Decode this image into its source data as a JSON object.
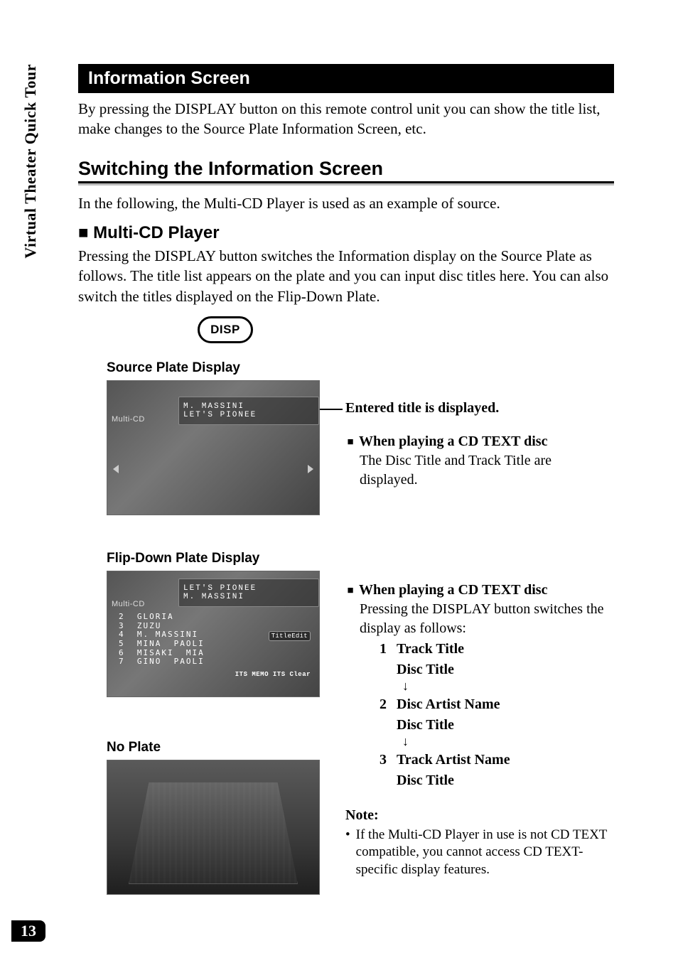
{
  "sidebar": {
    "tab_label": "Virtual Theater Quick Tour"
  },
  "page_number": "13",
  "header": {
    "title": "Information Screen"
  },
  "intro": "By pressing the DISPLAY button on this remote control unit you can show the title list, make changes to the Source Plate Information Screen, etc.",
  "section": {
    "heading": "Switching the Information Screen",
    "body": "In the following, the Multi-CD Player is used as an example of source."
  },
  "multicd": {
    "heading_prefix": "■  ",
    "heading": "Multi-CD Player",
    "body": "Pressing the DISPLAY button switches the Information display on the Source Plate as follows. The title list appears on the plate and you can input disc titles here. You can also switch the titles displayed on the Flip-Down Plate."
  },
  "disp_button_label": "DISP",
  "source_plate": {
    "label": "Source Plate Display",
    "callout": "Entered title is displayed.",
    "cdtext_title": "When playing a CD TEXT disc",
    "cdtext_body": "The Disc Title and Track Title are displayed.",
    "scr_source": "Multi-CD",
    "scr_line1": "M. MASSINI",
    "scr_line2": "LET'S  PIONEE"
  },
  "flip_down": {
    "label": "Flip-Down Plate Display",
    "cdtext_title": "When playing a CD TEXT disc",
    "cdtext_body": "Pressing the DISPLAY button switches the display as follows:",
    "items": [
      {
        "num": "1",
        "l1": "Track Title",
        "l2": "Disc Title"
      },
      {
        "num": "2",
        "l1": "Disc Artist Name",
        "l2": "Disc Title"
      },
      {
        "num": "3",
        "l1": "Track Artist Name",
        "l2": "Disc Title"
      }
    ],
    "down_arrow": "↓",
    "scr_source": "Multi-CD",
    "scr_line1": "LET'S  PIONEE",
    "scr_line2": "M. MASSINI",
    "scr_list": "2  GLORIA\n3  ZUZU\n4  M. MASSINI\n5  MINA  PAOLI\n6  MISAKI  MIA\n7  GINO  PAOLI",
    "scr_titleedit": "TitleEdit",
    "scr_its": "ITS MEMO ITS Clear"
  },
  "no_plate": {
    "label": "No Plate"
  },
  "note": {
    "heading": "Note:",
    "body": "If the Multi-CD Player in use is not CD TEXT compatible, you cannot access CD TEXT-specific display features."
  }
}
